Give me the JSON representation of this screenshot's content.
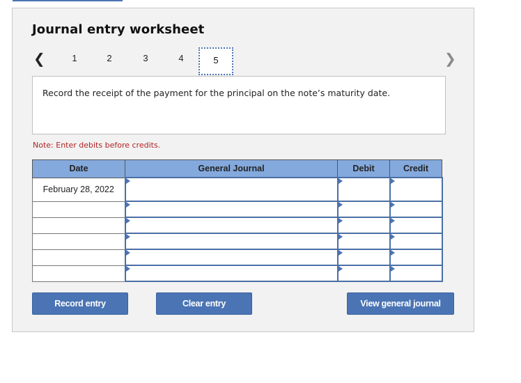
{
  "header": {
    "title": "Journal entry worksheet"
  },
  "navigation": {
    "prev_icon": "chevron-left-icon",
    "next_icon": "chevron-right-icon",
    "steps": [
      "1",
      "2",
      "3",
      "4",
      "5"
    ],
    "active_step": "5"
  },
  "instruction": "Record the receipt of the payment for the principal on the note’s maturity date.",
  "note": "Note: Enter debits before credits.",
  "table": {
    "columns": [
      "Date",
      "General Journal",
      "Debit",
      "Credit"
    ],
    "rows": [
      {
        "date": "February 28, 2022",
        "account": "",
        "debit": "",
        "credit": ""
      },
      {
        "date": "",
        "account": "",
        "debit": "",
        "credit": ""
      },
      {
        "date": "",
        "account": "",
        "debit": "",
        "credit": ""
      },
      {
        "date": "",
        "account": "",
        "debit": "",
        "credit": ""
      },
      {
        "date": "",
        "account": "",
        "debit": "",
        "credit": ""
      },
      {
        "date": "",
        "account": "",
        "debit": "",
        "credit": ""
      }
    ]
  },
  "buttons": {
    "record": "Record entry",
    "clear": "Clear entry",
    "view": "View general journal"
  },
  "colors": {
    "accent": "#4a74b4",
    "header_bg": "#84a9dd",
    "note": "#b22222"
  }
}
